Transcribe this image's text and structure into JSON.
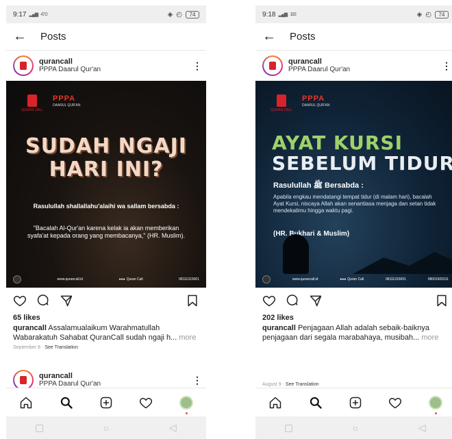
{
  "screens": [
    {
      "status": {
        "time": "9:17",
        "net_speed": "47.0",
        "battery": "74"
      },
      "header": {
        "title": "Posts"
      },
      "post": {
        "username": "qurancall",
        "subtitle": "PPPA Daarul Qur'an",
        "image": {
          "qc_label": "QURAN CALL",
          "pppa_mark": "PPPA",
          "pppa_label": "DAARUL QUR'AN",
          "headline_1": "SUDAH NGAJI",
          "headline_2": "HARI INI?",
          "attribution": "Rasulullah shallallahu'alaihi wa sallam bersabda :",
          "quote": "\"Bacalah Al-Qur'an karena kelak ia akan memberikan syafa'at kepada orang yang membacanya,\" (HR. Muslim).",
          "footer_site": "www.qurancall.id",
          "footer_social": "Quran Call",
          "footer_phone": "08111315001"
        },
        "likes": "65 likes",
        "caption_user": "qurancall",
        "caption_text": "Assalamualaikum Warahmatullah Wabarakatuh Sahabat QuranCall sudah ngaji h...",
        "more": "more",
        "date": "September 8",
        "see_translation": "See Translation"
      },
      "next_post": {
        "username": "qurancall",
        "subtitle": "PPPA Daarul Qur'an"
      }
    },
    {
      "status": {
        "time": "9:18",
        "net_speed": "183",
        "battery": "74"
      },
      "header": {
        "title": "Posts"
      },
      "post": {
        "username": "qurancall",
        "subtitle": "PPPA Daarul Qur'an",
        "image": {
          "qc_label": "QURAN CALL",
          "pppa_mark": "PPPA",
          "pppa_label": "DAARUL QUR'AN",
          "headline_1": "AYAT KURSI",
          "headline_2": "SEBELUM TIDUR",
          "attribution": "Rasulullah ﷺ Bersabda :",
          "body": "Apabila engkau mendatangi tempat tidur (di malam hari), bacalah Ayat Kursi, niscaya Allah akan senantiasa menjaga dan setan tidak mendekatimu hingga waktu pagi.",
          "reference": "(HR. Bukhari & Muslim)",
          "footer_site": "www.qurancall.id",
          "footer_social": "Quran Call",
          "footer_phone": "08111315001",
          "footer_phone_2": "08001500311"
        },
        "likes": "202 likes",
        "caption_user": "qurancall",
        "caption_text": "Penjagaan Allah adalah sebaik-baiknya penjagaan dari segala marabahaya, musibah...",
        "more": "more",
        "date": "August 9",
        "see_translation": "See Translation"
      }
    }
  ]
}
